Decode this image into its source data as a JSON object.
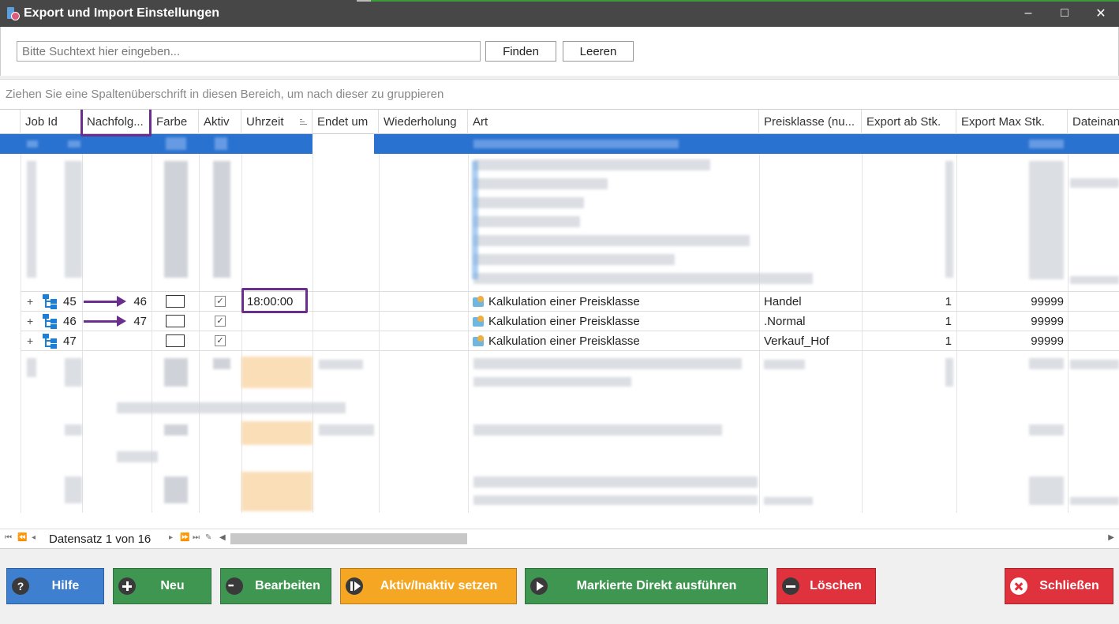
{
  "window": {
    "title": "Export und Import Einstellungen",
    "minimize": "–",
    "maximize": "□",
    "close": "✕"
  },
  "search": {
    "placeholder": "Bitte Suchtext hier eingeben...",
    "find_label": "Finden",
    "clear_label": "Leeren"
  },
  "group_panel": {
    "hint": "Ziehen Sie eine Spaltenüberschrift in diesen Bereich, um nach dieser zu gruppieren"
  },
  "grid": {
    "columns": [
      "Job Id",
      "Nachfolg...",
      "Farbe",
      "Aktiv",
      "Uhrzeit",
      "Endet um",
      "Wiederholung",
      "Art",
      "Preisklasse (nu...",
      "Export ab Stk.",
      "Export Max Stk.",
      "Dateinan"
    ],
    "rows": [
      {
        "expander": "+",
        "job_id": "45",
        "nachfolger": "46",
        "aktiv_check": "✓",
        "uhrzeit": "18:00:00",
        "art": "Kalkulation einer Preisklasse",
        "preisklasse": "Handel",
        "export_ab": "1",
        "export_max": "99999"
      },
      {
        "expander": "+",
        "job_id": "46",
        "nachfolger": "47",
        "aktiv_check": "✓",
        "uhrzeit": "",
        "art": "Kalkulation einer Preisklasse",
        "preisklasse": ".Normal",
        "export_ab": "1",
        "export_max": "99999"
      },
      {
        "expander": "+",
        "job_id": "47",
        "nachfolger": "",
        "aktiv_check": "✓",
        "uhrzeit": "",
        "art": "Kalkulation einer Preisklasse",
        "preisklasse": "Verkauf_Hof",
        "export_ab": "1",
        "export_max": "99999"
      }
    ],
    "row_indicator": "→"
  },
  "navigator": {
    "record_text": "Datensatz 1 von 16"
  },
  "actions": {
    "help": "Hilfe",
    "new": "Neu",
    "edit": "Bearbeiten",
    "toggle_active": "Aktiv/Inaktiv setzen",
    "run_selected": "Markierte Direkt ausführen",
    "delete": "Löschen",
    "close": "Schließen",
    "help_icon_glyph": "?"
  },
  "colors": {
    "help": "#3f7fd0",
    "new": "#3f9650",
    "edit": "#3f9650",
    "toggle_active": "#f5a623",
    "run_selected": "#3f9650",
    "delete": "#e0323c",
    "close": "#e0323c",
    "selection": "#2a72d0",
    "annotation": "#6a2e8c"
  }
}
